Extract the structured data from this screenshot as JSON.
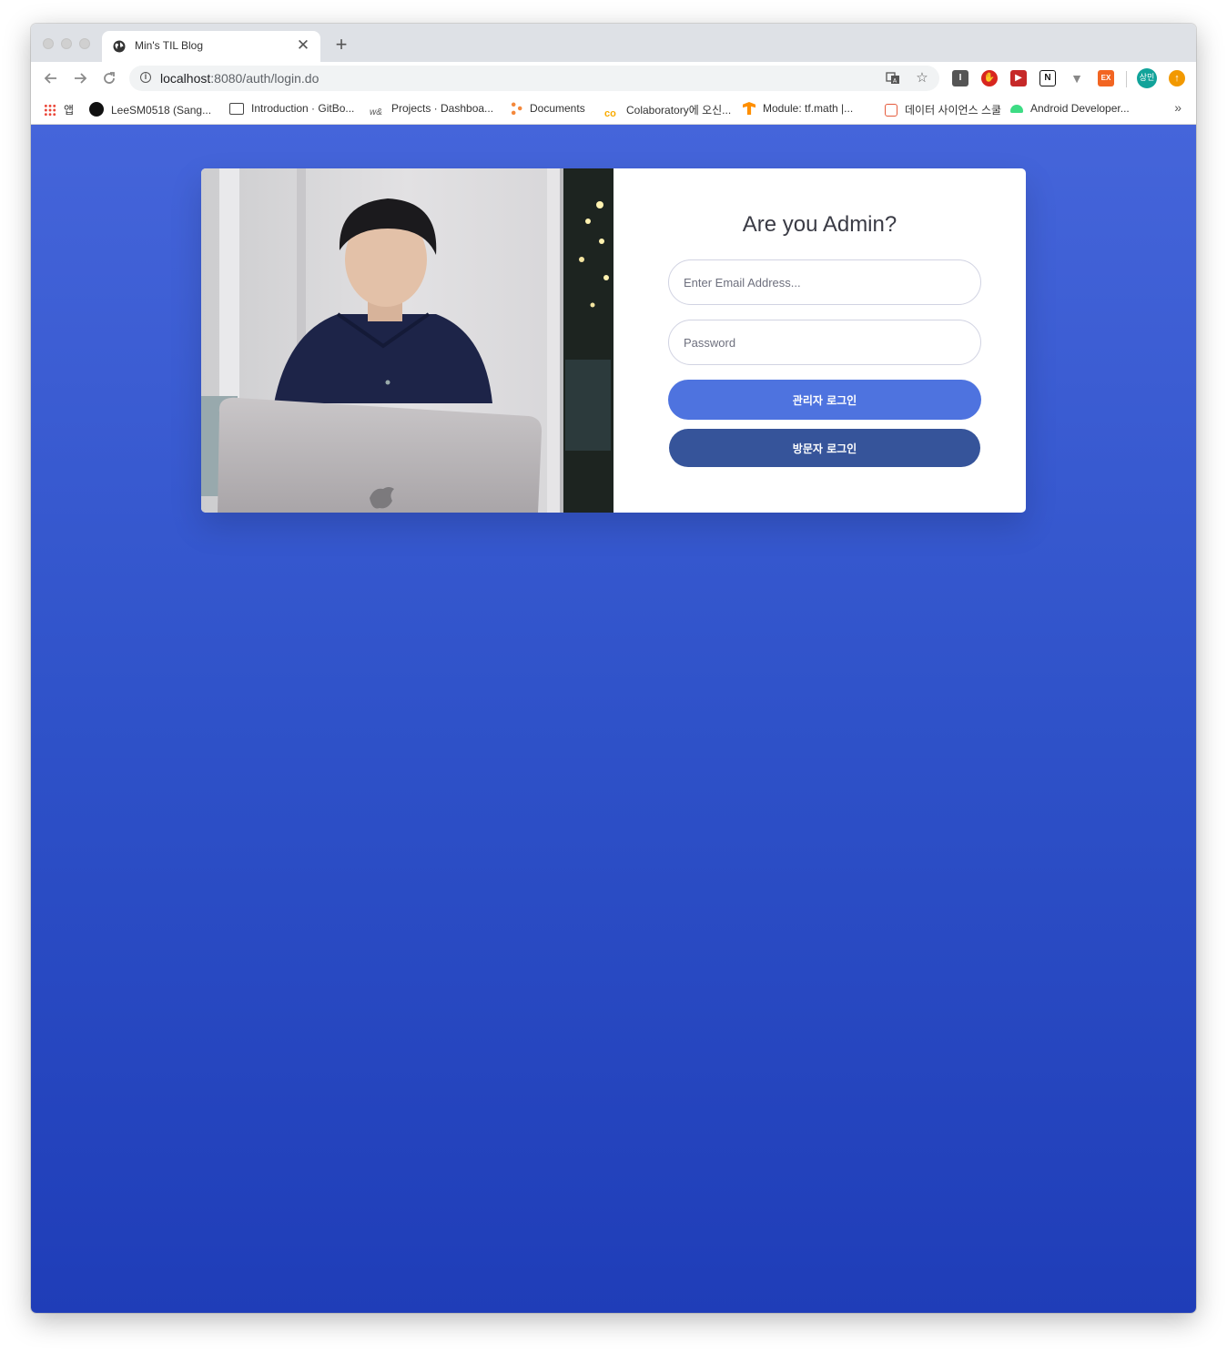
{
  "browser": {
    "tab": {
      "title": "Min's TIL Blog",
      "close": "✕"
    },
    "new_tab": "+",
    "url_host": "localhost",
    "url_path": ":8080/auth/login.do",
    "account_avatar": "상민",
    "bookmarks": [
      {
        "label": "앱",
        "icon": "apps-grid-icon"
      },
      {
        "label": "LeeSM0518 (Sang...",
        "icon": "github-icon"
      },
      {
        "label": "Introduction · GitBo...",
        "icon": "gitbook-icon"
      },
      {
        "label": "Projects · Dashboa...",
        "icon": "wandb-icon"
      },
      {
        "label": "Documents",
        "icon": "documents-icon"
      },
      {
        "label": "Colaboratory에 오신...",
        "icon": "colab-icon"
      },
      {
        "label": "Module: tf.math  |...",
        "icon": "tensorflow-icon"
      },
      {
        "label": "데이터 사이언스 스쿨",
        "icon": "datascience-school-icon"
      },
      {
        "label": "Android Developer...",
        "icon": "android-icon"
      }
    ],
    "bookmarks_more": "»"
  },
  "login": {
    "title": "Are you Admin?",
    "email_placeholder": "Enter Email Address...",
    "password_placeholder": "Password",
    "admin_button": "관리자 로그인",
    "visitor_button": "방문자 로그인"
  },
  "colors": {
    "background_top": "#4565da",
    "background_bottom": "#1f3db8",
    "admin_button": "#4e73df",
    "visitor_button": "#36549a"
  }
}
